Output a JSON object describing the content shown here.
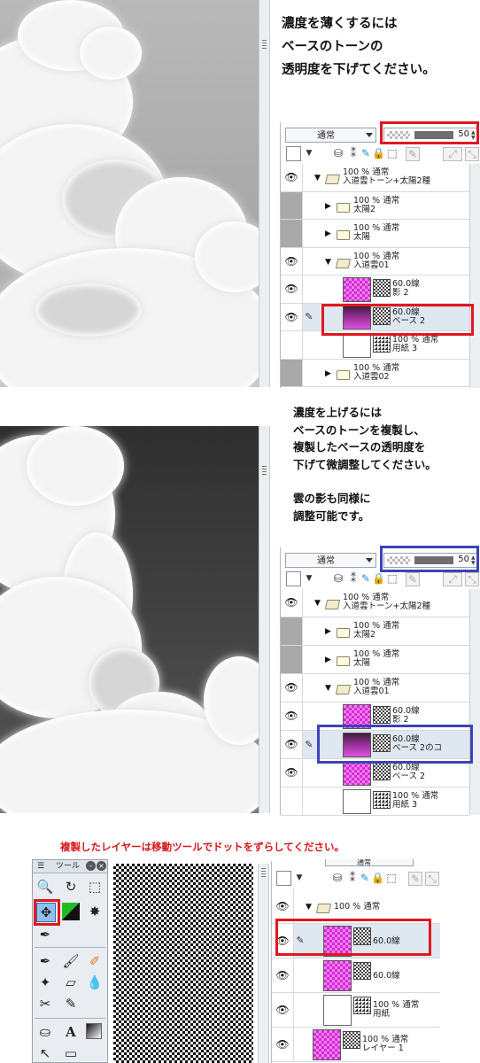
{
  "section1": {
    "note_lines": [
      "濃度を薄くするには",
      "ベースのトーンの",
      "透明度を下げてください。"
    ],
    "blend_mode": "通常",
    "opacity": "50",
    "layers": [
      {
        "eye": true,
        "gray": false,
        "indent": 1,
        "kind": "folder-open",
        "line1": "100 % 通常",
        "line2": "入道雲トーン+太陽2種"
      },
      {
        "eye": false,
        "gray": true,
        "indent": 2,
        "kind": "folder",
        "line1": "100 % 通常",
        "line2": "太陽2"
      },
      {
        "eye": false,
        "gray": true,
        "indent": 2,
        "kind": "folder",
        "line1": "100 % 通常",
        "line2": "太陽"
      },
      {
        "eye": true,
        "gray": false,
        "indent": 2,
        "kind": "folder-open",
        "line1": "100 % 通常",
        "line2": "入道雲01"
      },
      {
        "eye": true,
        "gray": false,
        "indent": 3,
        "kind": "tone",
        "line1": "60.0線",
        "line2": "影 2"
      },
      {
        "eye": true,
        "gray": false,
        "indent": 3,
        "kind": "tone-dark",
        "line1": "60.0線",
        "line2": "ベース 2",
        "selected": true
      },
      {
        "eye": false,
        "gray": false,
        "indent": 3,
        "kind": "paper",
        "line1": "100 % 通常",
        "line2": "用紙 3"
      },
      {
        "eye": false,
        "gray": true,
        "indent": 2,
        "kind": "folder",
        "line1": "100 % 通常",
        "line2": "入道雲02"
      }
    ]
  },
  "section2": {
    "note_lines": [
      "濃度を上げるには",
      "ベースのトーンを複製し、",
      "複製したベースの透明度を",
      "下げて微調整してください。",
      "",
      "雲の影も同様に",
      "調整可能です。"
    ],
    "blend_mode": "通常",
    "opacity": "50",
    "layers": [
      {
        "eye": true,
        "gray": false,
        "indent": 1,
        "kind": "folder-open",
        "line1": "100 % 通常",
        "line2": "入道雲トーン+太陽2種"
      },
      {
        "eye": false,
        "gray": true,
        "indent": 2,
        "kind": "folder",
        "line1": "100 % 通常",
        "line2": "太陽2"
      },
      {
        "eye": false,
        "gray": true,
        "indent": 2,
        "kind": "folder",
        "line1": "100 % 通常",
        "line2": "太陽"
      },
      {
        "eye": true,
        "gray": false,
        "indent": 2,
        "kind": "folder-open",
        "line1": "100 % 通常",
        "line2": "入道雲01"
      },
      {
        "eye": true,
        "gray": false,
        "indent": 3,
        "kind": "tone",
        "line1": "60.0線",
        "line2": "影 2"
      },
      {
        "eye": true,
        "gray": false,
        "indent": 3,
        "kind": "tone-dark",
        "line1": "60.0線",
        "line2": "ベース 2のコ",
        "selected": true
      },
      {
        "eye": true,
        "gray": false,
        "indent": 3,
        "kind": "tone",
        "line1": "60.0線",
        "line2": "ベース 2"
      },
      {
        "eye": false,
        "gray": false,
        "indent": 3,
        "kind": "paper",
        "line1": "100 % 通常",
        "line2": "用紙 3"
      }
    ]
  },
  "section3": {
    "title": "複製したレイヤーは移動ツールでドットをずらしてください。",
    "tool_panel_title": "ツール",
    "blend_mode": "通常",
    "layers": [
      {
        "eye": true,
        "indent": 1,
        "kind": "folder-open",
        "line1": "100 % 通常",
        "line2": ""
      },
      {
        "eye": true,
        "indent": 2,
        "kind": "tone",
        "line1": "60.0線",
        "line2": "",
        "selected": true
      },
      {
        "eye": true,
        "indent": 2,
        "kind": "tone",
        "line1": "60.0線",
        "line2": ""
      },
      {
        "eye": true,
        "indent": 2,
        "kind": "paper",
        "line1": "100 % 通常",
        "line2": "用紙"
      },
      {
        "eye": true,
        "indent": 1,
        "kind": "tone",
        "line1": "100 % 通常",
        "line2": "レイヤー 1"
      }
    ]
  },
  "colors": {
    "highlight_red": "#e0171f",
    "highlight_blue": "#3c43b8",
    "tone_magenta": "#ff55ff"
  }
}
